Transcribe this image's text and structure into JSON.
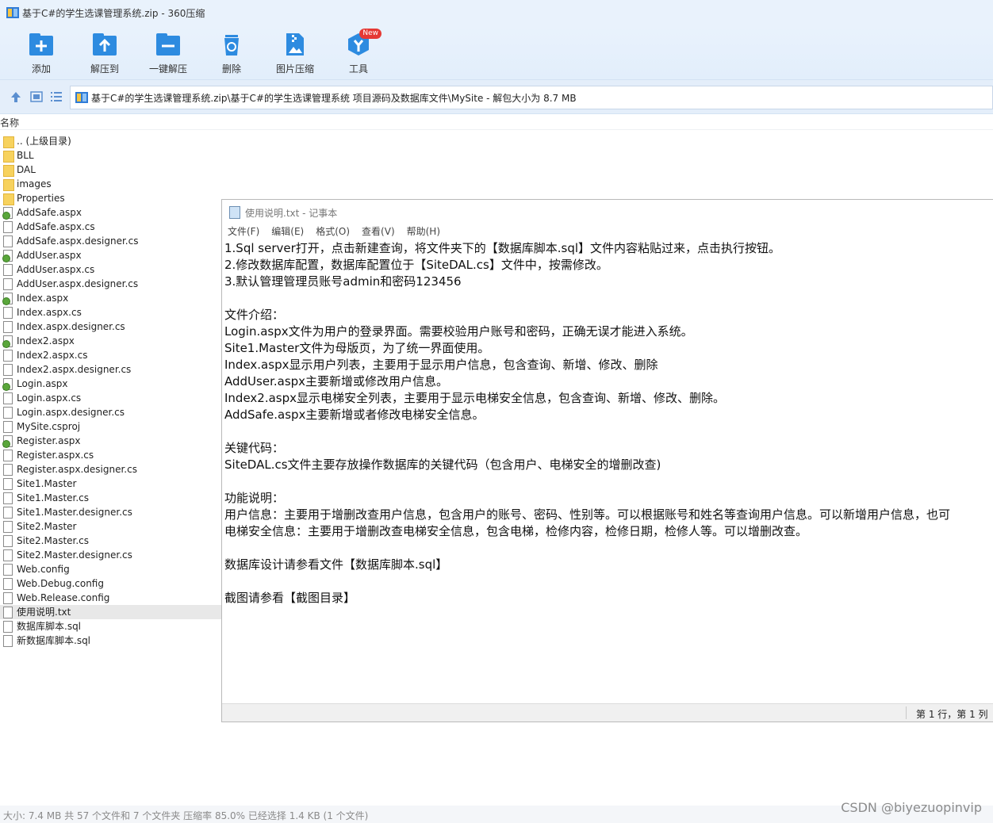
{
  "window": {
    "title": "基于C#的学生选课管理系统.zip - 360压缩"
  },
  "toolbar": {
    "add": "添加",
    "extract_to": "解压到",
    "one_click_extract": "一键解压",
    "delete": "删除",
    "image_compress": "图片压缩",
    "tools": "工具",
    "tools_badge": "New"
  },
  "address": {
    "path": "基于C#的学生选课管理系统.zip\\基于C#的学生选课管理系统 项目源码及数据库文件\\MySite - 解包大小为 8.7 MB"
  },
  "list": {
    "header_name": "名称",
    "items": [
      {
        "name": ".. (上级目录)",
        "icon": "folder"
      },
      {
        "name": "BLL",
        "icon": "folder"
      },
      {
        "name": "DAL",
        "icon": "folder"
      },
      {
        "name": "images",
        "icon": "folder"
      },
      {
        "name": "Properties",
        "icon": "folder"
      },
      {
        "name": "AddSafe.aspx",
        "icon": "aspx"
      },
      {
        "name": "AddSafe.aspx.cs",
        "icon": "doc"
      },
      {
        "name": "AddSafe.aspx.designer.cs",
        "icon": "doc"
      },
      {
        "name": "AddUser.aspx",
        "icon": "aspx"
      },
      {
        "name": "AddUser.aspx.cs",
        "icon": "doc"
      },
      {
        "name": "AddUser.aspx.designer.cs",
        "icon": "doc"
      },
      {
        "name": "Index.aspx",
        "icon": "aspx"
      },
      {
        "name": "Index.aspx.cs",
        "icon": "doc"
      },
      {
        "name": "Index.aspx.designer.cs",
        "icon": "doc"
      },
      {
        "name": "Index2.aspx",
        "icon": "aspx"
      },
      {
        "name": "Index2.aspx.cs",
        "icon": "doc"
      },
      {
        "name": "Index2.aspx.designer.cs",
        "icon": "doc"
      },
      {
        "name": "Login.aspx",
        "icon": "aspx"
      },
      {
        "name": "Login.aspx.cs",
        "icon": "doc"
      },
      {
        "name": "Login.aspx.designer.cs",
        "icon": "doc"
      },
      {
        "name": "MySite.csproj",
        "icon": "doc"
      },
      {
        "name": "Register.aspx",
        "icon": "aspx"
      },
      {
        "name": "Register.aspx.cs",
        "icon": "doc"
      },
      {
        "name": "Register.aspx.designer.cs",
        "icon": "doc"
      },
      {
        "name": "Site1.Master",
        "icon": "doc"
      },
      {
        "name": "Site1.Master.cs",
        "icon": "doc"
      },
      {
        "name": "Site1.Master.designer.cs",
        "icon": "doc"
      },
      {
        "name": "Site2.Master",
        "icon": "doc"
      },
      {
        "name": "Site2.Master.cs",
        "icon": "doc"
      },
      {
        "name": "Site2.Master.designer.cs",
        "icon": "doc"
      },
      {
        "name": "Web.config",
        "icon": "doc"
      },
      {
        "name": "Web.Debug.config",
        "icon": "doc"
      },
      {
        "name": "Web.Release.config",
        "icon": "doc"
      },
      {
        "name": "使用说明.txt",
        "icon": "doc",
        "selected": true
      },
      {
        "name": "数据库脚本.sql",
        "icon": "doc"
      },
      {
        "name": "新数据库脚本.sql",
        "icon": "doc"
      }
    ]
  },
  "notepad": {
    "title": "使用说明.txt - 记事本",
    "menu": [
      "文件(F)",
      "编辑(E)",
      "格式(O)",
      "查看(V)",
      "帮助(H)"
    ],
    "lines": [
      "1.Sql server打开，点击新建查询，将文件夹下的【数据库脚本.sql】文件内容粘贴过来，点击执行按钮。",
      "2.修改数据库配置，数据库配置位于【SiteDAL.cs】文件中，按需修改。",
      "3.默认管理管理员账号admin和密码123456",
      "",
      "文件介绍：",
      "Login.aspx文件为用户的登录界面。需要校验用户账号和密码，正确无误才能进入系统。",
      "Site1.Master文件为母版页，为了统一界面使用。",
      "Index.aspx显示用户列表，主要用于显示用户信息，包含查询、新增、修改、删除",
      "AddUser.aspx主要新增或修改用户信息。",
      "Index2.aspx显示电梯安全列表，主要用于显示电梯安全信息，包含查询、新增、修改、删除。",
      "AddSafe.aspx主要新增或者修改电梯安全信息。",
      "",
      "关键代码：",
      "SiteDAL.cs文件主要存放操作数据库的关键代码（包含用户、电梯安全的增删改查)",
      "",
      "功能说明：",
      "用户信息：主要用于增删改查用户信息，包含用户的账号、密码、性别等。可以根据账号和姓名等查询用户信息。可以新增用户信息，也可",
      "电梯安全信息：主要用于增删改查电梯安全信息，包含电梯，检修内容，检修日期，检修人等。可以增删改查。",
      "",
      "数据库设计请参看文件【数据库脚本.sql】",
      "",
      "截图请参看【截图目录】"
    ],
    "status_position": "第 1 行，第 1 列"
  },
  "statusbar": {
    "text": "大小: 7.4 MB 共 57 个文件和 7 个文件夹 压缩率 85.0% 已经选择 1.4 KB (1 个文件)"
  },
  "watermark": "CSDN @biyezuopinvip"
}
